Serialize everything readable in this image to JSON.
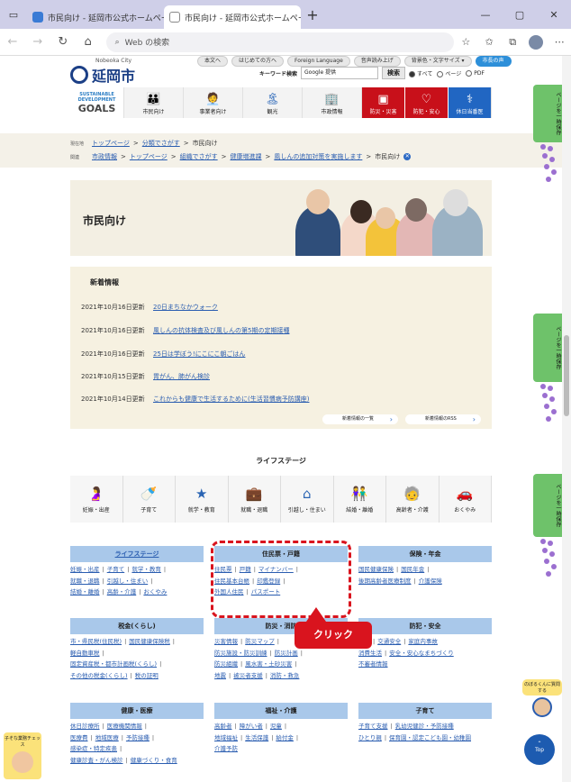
{
  "browser": {
    "tabs": [
      {
        "title": "市民向け - 延岡市公式ホームページ",
        "active": false
      },
      {
        "title": "市民向け - 延岡市公式ホームページ",
        "active": true
      }
    ],
    "address_placeholder": "Web の検索"
  },
  "header": {
    "logo_sub": "Nobeoka City",
    "logo_main": "延岡市",
    "top_links": [
      "本文へ",
      "はじめての方へ",
      "Foreign Language",
      "音声読み上げ",
      "背景色・文字サイズ ▾",
      "市長の声"
    ],
    "keyword_label": "キーワード検索",
    "search_value": "Google 提供",
    "search_button": "検索",
    "radio_all": "すべて",
    "radio_page": "ページ",
    "radio_pdf": "PDF"
  },
  "nav": {
    "sdgs_line1": "SUSTAINABLE",
    "sdgs_line2": "DEVELOPMENT",
    "sdgs_goals": "GOALS",
    "items": [
      "市民向け",
      "事業者向け",
      "観光",
      "市政情報"
    ],
    "red1": "防災・災害",
    "red2": "防犯・安心",
    "blue": "休日当番医"
  },
  "breadcrumbs": {
    "row1_tag": "現在地",
    "row1": [
      "トップページ",
      "分類でさがす",
      "市民向け"
    ],
    "row2_tag": "関連",
    "row2": [
      "市政情報",
      "トップページ",
      "組織でさがす",
      "健康増進課",
      "風しんの追加対策を実施します",
      "市民向け"
    ]
  },
  "hero_title": "市民向け",
  "news": {
    "heading": "新着情報",
    "items": [
      {
        "date": "2021年10月16日更新",
        "title": "20日まちなかウォーク"
      },
      {
        "date": "2021年10月16日更新",
        "title": "風しんの抗体検査及び風しんの第5期の定期接種"
      },
      {
        "date": "2021年10月16日更新",
        "title": "25日は学ぼう!にこにこ朝ごはん"
      },
      {
        "date": "2021年10月15日更新",
        "title": "胃がん、肺がん検診"
      },
      {
        "date": "2021年10月14日更新",
        "title": "これからも健康で生活するために(生活習慣病予防講座)"
      }
    ],
    "btn_list": "新着情報の一覧",
    "btn_rss": "新着情報のRSS"
  },
  "life_stage": {
    "heading": "ライフステージ",
    "items": [
      "妊娠・出産",
      "子育て",
      "就学・教育",
      "就職・退職",
      "引越し・住まい",
      "結婚・離婚",
      "高齢者・介護",
      "おくやみ"
    ]
  },
  "categories": [
    {
      "title": "ライフステージ",
      "links": [
        "妊娠・出産",
        "子育て",
        "就学・教育",
        "就職・退職",
        "引越し・住まい",
        "結婚・離婚",
        "高齢・介護",
        "おくやみ"
      ]
    },
    {
      "title": "住民票・戸籍",
      "links": [
        "住民票",
        "戸籍",
        "マイナンバー",
        "住民基本台帳",
        "印鑑登録",
        "外国人住民",
        "パスポート"
      ]
    },
    {
      "title": "保険・年金",
      "links": [
        "国民健康保険",
        "国民年金",
        "後期高齢者医療制度",
        "介護保険"
      ]
    },
    {
      "title": "税金(くらし)",
      "links": [
        "市・県民税(住民税)",
        "国民健康保険税",
        "軽自動車税",
        "固定資産税・都市計画税(くらし)",
        "その他の税金(くらし)",
        "税の証明"
      ]
    },
    {
      "title": "防災・消防",
      "links": [
        "災害情報",
        "防災マップ",
        "防災施設・防災訓練",
        "防災計画",
        "防災組織",
        "風水害・土砂災害",
        "地震",
        "被災者支援",
        "消防・救急"
      ]
    },
    {
      "title": "防犯・安全",
      "links": [
        "防犯",
        "交通安全",
        "家庭内事故",
        "消費生活",
        "安全・安心なまちづくり",
        "不審者情報"
      ]
    },
    {
      "title": "健康・医療",
      "links": [
        "休日診療所",
        "医療機関情報",
        "医療費",
        "地域医療",
        "予防接種",
        "感染症・特定疾患",
        "健康診査・がん検診",
        "健康づくり・食育"
      ]
    },
    {
      "title": "福祉・介護",
      "links": [
        "高齢者",
        "障がい者",
        "児童",
        "地域福祉",
        "生活保護",
        "給付金",
        "介護予防"
      ]
    },
    {
      "title": "子育て",
      "links": [
        "子育て支援",
        "乳幼児健診・予防接種",
        "ひとり親",
        "保育園・認定こども園・幼稚園"
      ]
    }
  ],
  "annotation": {
    "callout": "クリック"
  },
  "side_tab": "ページを一時保存",
  "mascot_text": "のぼるくんに質問する",
  "badge_text": "子そな業務チェッス",
  "top_button": "Top"
}
